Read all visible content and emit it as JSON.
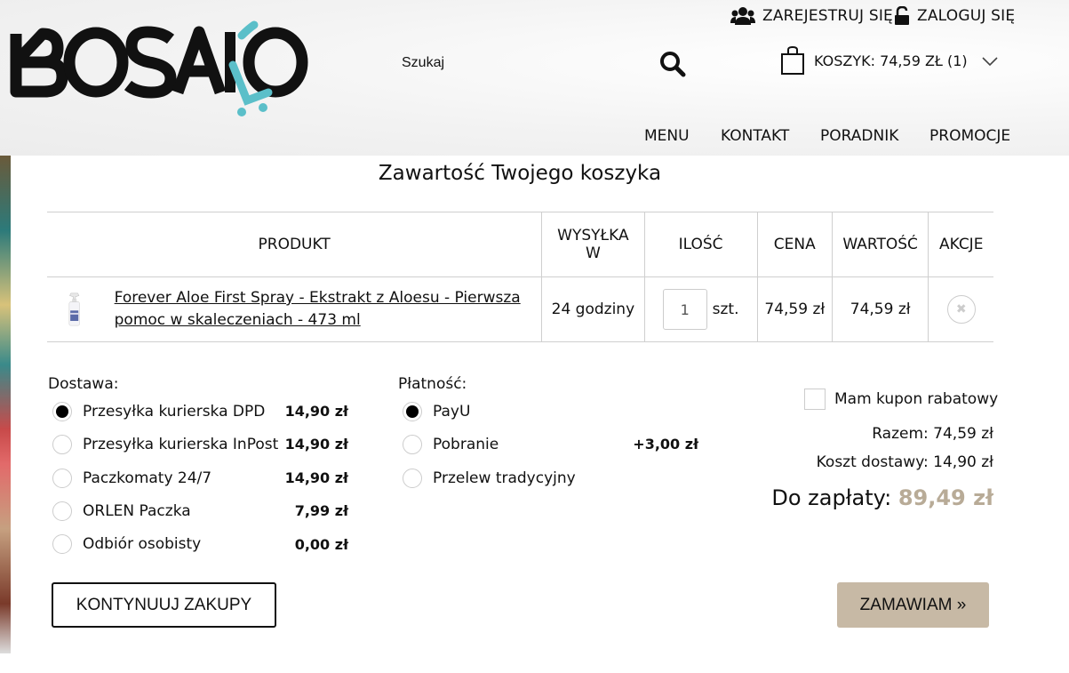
{
  "header": {
    "logo_text": "BOSAKO",
    "register_label": "ZAREJESTRUJ SIĘ",
    "login_label": "ZALOGUJ SIĘ",
    "search_placeholder": "Szukaj",
    "cart_label": "KOSZYK: 74,59 ZŁ (1)",
    "icons": [
      "users-icon",
      "lock-icon",
      "search-icon",
      "shopping-bag-icon",
      "chevron-down-icon"
    ]
  },
  "nav": {
    "items": [
      {
        "label": "MENU"
      },
      {
        "label": "KONTAKT"
      },
      {
        "label": "PORADNIK"
      },
      {
        "label": "PROMOCJE"
      }
    ]
  },
  "page_title": "Zawartość Twojego koszyka",
  "table": {
    "headers": {
      "product": "PRODUKT",
      "shipping_line1": "WYSYŁKA",
      "shipping_line2": "W",
      "qty": "ILOŚĆ",
      "price": "CENA",
      "value": "WARTOŚĆ",
      "actions": "AKCJE"
    },
    "rows": [
      {
        "product_name": "Forever Aloe First Spray - Ekstrakt z Aloesu - Pierwsza pomoc w skaleczeniach - 473 ml",
        "shipping": "24 godziny",
        "qty": "1",
        "unit": "szt.",
        "price": "74,59 zł",
        "value": "74,59 zł"
      }
    ]
  },
  "delivery": {
    "label": "Dostawa:",
    "options": [
      {
        "label": "Przesyłka kurierska DPD",
        "price": "14,90 zł",
        "selected": true
      },
      {
        "label": "Przesyłka kurierska InPost",
        "price": "14,90 zł",
        "selected": false
      },
      {
        "label": "Paczkomaty 24/7",
        "price": "14,90 zł",
        "selected": false
      },
      {
        "label": "ORLEN Paczka",
        "price": "7,99 zł",
        "selected": false
      },
      {
        "label": "Odbiór osobisty",
        "price": "0,00 zł",
        "selected": false
      }
    ]
  },
  "payment": {
    "label": "Płatność:",
    "options": [
      {
        "label": "PayU",
        "price": "",
        "selected": true
      },
      {
        "label": "Pobranie",
        "price": "+3,00 zł",
        "selected": false
      },
      {
        "label": "Przelew tradycyjny",
        "price": "",
        "selected": false
      }
    ]
  },
  "summary": {
    "coupon_label": "Mam kupon rabatowy",
    "subtotal": "Razem: 74,59 zł",
    "shipping_cost": "Koszt dostawy: 14,90 zł",
    "total_label": "Do zapłaty:",
    "total_value": "89,49 zł"
  },
  "actions": {
    "continue_label": "KONTYNUUJ ZAKUPY",
    "order_label": "ZAMAWIAM »"
  },
  "colors": {
    "accent_button": "#c7b9a5",
    "total_value": "#b8ab97",
    "logo_teal": "#5bbfc9"
  }
}
